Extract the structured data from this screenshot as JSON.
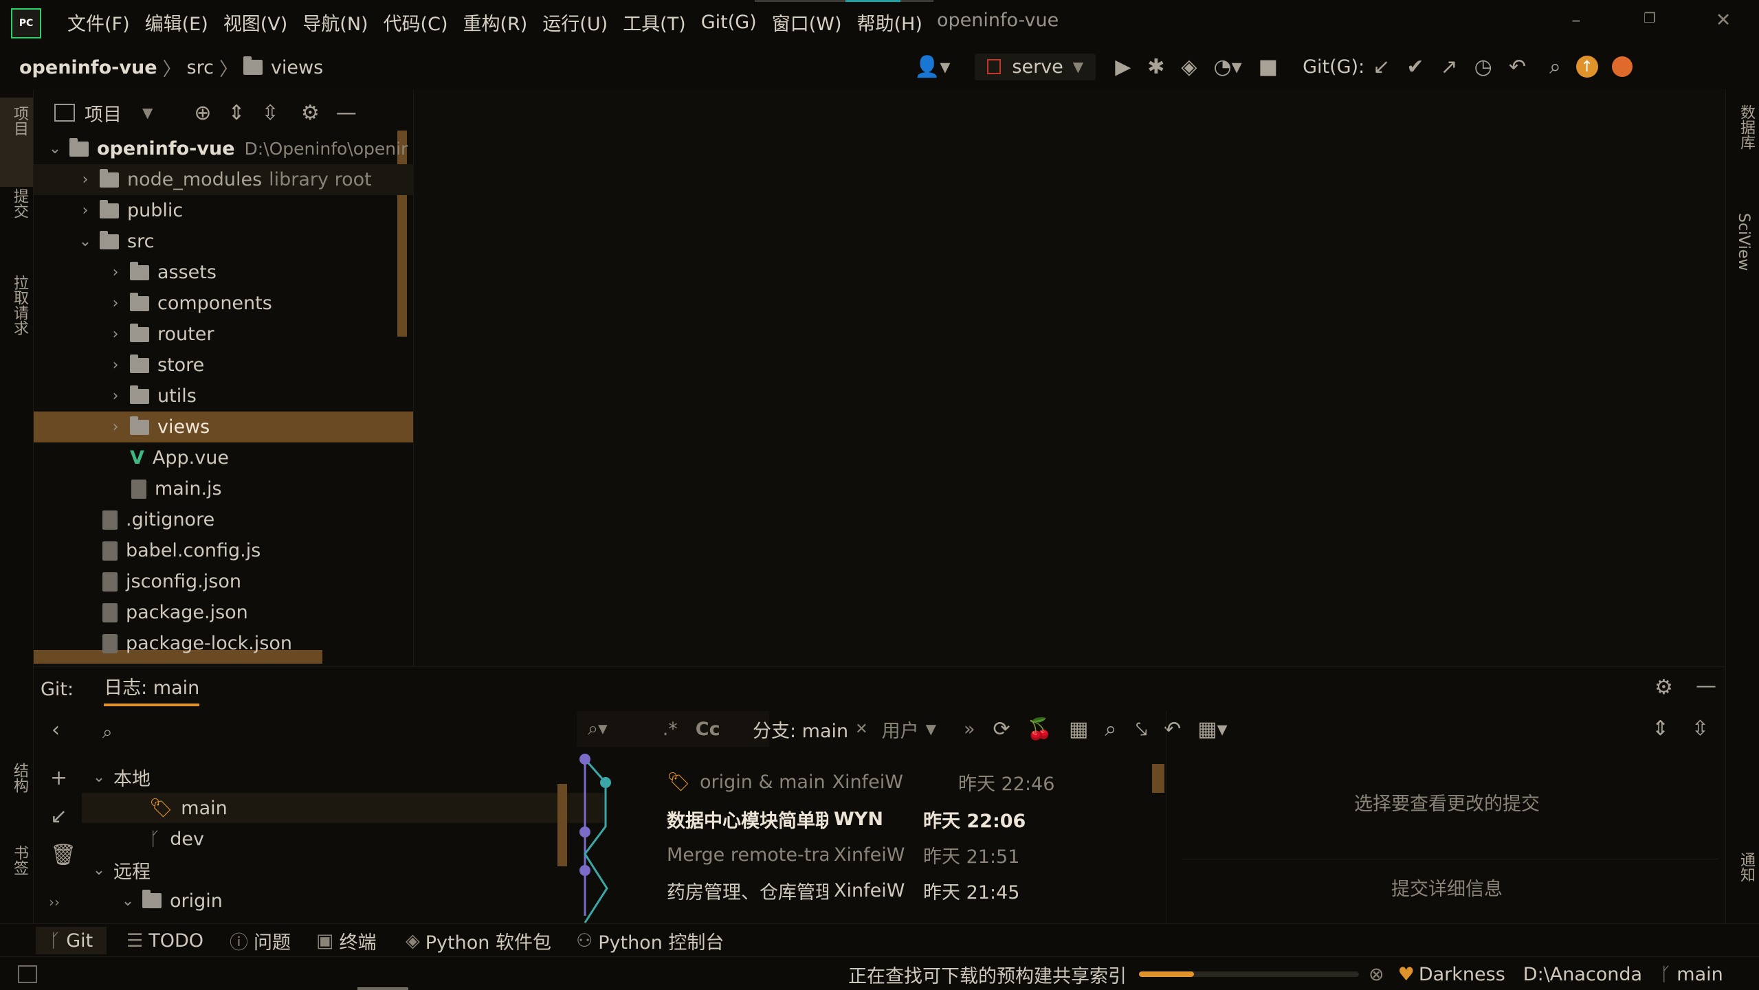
{
  "app": {
    "logo_text": "PC",
    "window_title": "openinfo-vue",
    "menu": [
      "文件(F)",
      "编辑(E)",
      "视图(V)",
      "导航(N)",
      "代码(C)",
      "重构(R)",
      "运行(U)",
      "工具(T)",
      "Git(G)",
      "窗口(W)",
      "帮助(H)"
    ]
  },
  "breadcrumb": {
    "project": "openinfo-vue",
    "sep1": "〉",
    "src": "src",
    "sep2": "〉",
    "views": "views"
  },
  "toolbar": {
    "run_config": "serve",
    "git_label": "Git(G):"
  },
  "left_strip": {
    "project": "项目",
    "commit": "提交",
    "pull_requests": "拉取请求",
    "structure": "结构",
    "bookmarks": "书签"
  },
  "right_strip": {
    "database": "数据库",
    "sciview": "SciView",
    "notifications": "通知"
  },
  "project_panel": {
    "title": "项目",
    "root_name": "openinfo-vue",
    "root_path": "D:\\Openinfo\\openir",
    "items": [
      {
        "label": "node_modules",
        "suffix": "library root",
        "kind": "folder"
      },
      {
        "label": "public",
        "kind": "folder"
      },
      {
        "label": "src",
        "kind": "folder"
      },
      {
        "label": "assets",
        "kind": "folder"
      },
      {
        "label": "components",
        "kind": "folder"
      },
      {
        "label": "router",
        "kind": "folder"
      },
      {
        "label": "store",
        "kind": "folder"
      },
      {
        "label": "utils",
        "kind": "folder"
      },
      {
        "label": "views",
        "kind": "folder"
      },
      {
        "label": "App.vue",
        "kind": "vue"
      },
      {
        "label": "main.js",
        "kind": "js"
      },
      {
        "label": ".gitignore",
        "kind": "ignore"
      },
      {
        "label": "babel.config.js",
        "kind": "js"
      },
      {
        "label": "jsconfig.json",
        "kind": "json"
      },
      {
        "label": "package.json",
        "kind": "json"
      },
      {
        "label": "package-lock.json",
        "kind": "json"
      }
    ]
  },
  "git_panel": {
    "label": "Git:",
    "tab": "日志: main",
    "branches": {
      "local": "本地",
      "main": "main",
      "dev": "dev",
      "remote": "远程",
      "origin": "origin"
    },
    "filter": {
      "regex": ".*",
      "case": "Cc",
      "branch": "分支: main",
      "user": "用户",
      "more": "»"
    },
    "commits": [
      {
        "msg": "origin & main",
        "author": "XinfeiW",
        "time": "昨天 22:46"
      },
      {
        "msg": "数据中心模块简单联",
        "author": "WYN",
        "time": "昨天 22:06"
      },
      {
        "msg": "Merge remote-track",
        "author": "XinfeiW",
        "time": "昨天 21:51"
      },
      {
        "msg": "药房管理、仓库管理",
        "author": "XinfeiW",
        "time": "昨天 21:45"
      }
    ],
    "details_hint": "选择要查看更改的提交",
    "details_title": "提交详细信息"
  },
  "tool_windows": [
    "Git",
    "TODO",
    "问题",
    "终端",
    "Python 软件包",
    "Python 控制台"
  ],
  "status": {
    "progress_text": "正在查找可下载的预构建共享索引",
    "progress": 0.25,
    "theme": "Darkness",
    "interpreter": "D:\\Anaconda",
    "branch": "main"
  },
  "colors": {
    "accent": "#e0922b",
    "selection": "#6a4a22",
    "background": "#0f0d0a"
  }
}
